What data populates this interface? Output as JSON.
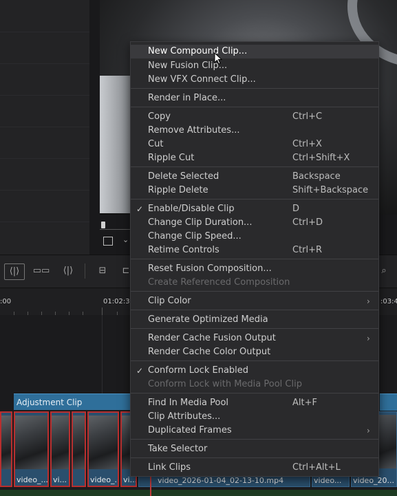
{
  "ruler": {
    "timecode_1": ":00",
    "timecode_2": "01:02:3",
    "timecode_3": ":03:4"
  },
  "adjustment_clip": {
    "label": "Adjustment Clip"
  },
  "clips": [
    {
      "name": "video_..."
    },
    {
      "name": "vi..."
    },
    {
      "name": ""
    },
    {
      "name": "video_..."
    },
    {
      "name": "vi..."
    },
    {
      "name": "video_2026-01-04_02-13-10.mp4"
    },
    {
      "name": "video..."
    },
    {
      "name": "video_20..."
    }
  ],
  "context_menu": {
    "items": {
      "new_compound_clip": {
        "label": "New Compound Clip..."
      },
      "new_fusion_clip": {
        "label": "New Fusion Clip..."
      },
      "new_vfx_connect_clip": {
        "label": "New VFX Connect Clip..."
      },
      "render_in_place": {
        "label": "Render in Place..."
      },
      "copy": {
        "label": "Copy",
        "shortcut": "Ctrl+C"
      },
      "remove_attributes": {
        "label": "Remove Attributes..."
      },
      "cut": {
        "label": "Cut",
        "shortcut": "Ctrl+X"
      },
      "ripple_cut": {
        "label": "Ripple Cut",
        "shortcut": "Ctrl+Shift+X"
      },
      "delete_selected": {
        "label": "Delete Selected",
        "shortcut": "Backspace"
      },
      "ripple_delete": {
        "label": "Ripple Delete",
        "shortcut": "Shift+Backspace"
      },
      "enable_disable_clip": {
        "label": "Enable/Disable Clip",
        "shortcut": "D",
        "checked": "✓"
      },
      "change_clip_duration": {
        "label": "Change Clip Duration...",
        "shortcut": "Ctrl+D"
      },
      "change_clip_speed": {
        "label": "Change Clip Speed..."
      },
      "retime_controls": {
        "label": "Retime Controls",
        "shortcut": "Ctrl+R"
      },
      "reset_fusion_composition": {
        "label": "Reset Fusion Composition..."
      },
      "create_referenced_composition": {
        "label": "Create Referenced Composition"
      },
      "clip_color": {
        "label": "Clip Color"
      },
      "generate_optimized_media": {
        "label": "Generate Optimized Media"
      },
      "render_cache_fusion_output": {
        "label": "Render Cache Fusion Output"
      },
      "render_cache_color_output": {
        "label": "Render Cache Color Output"
      },
      "conform_lock_enabled": {
        "label": "Conform Lock Enabled",
        "checked": "✓"
      },
      "conform_lock_media_pool_clip": {
        "label": "Conform Lock with Media Pool Clip"
      },
      "find_in_media_pool": {
        "label": "Find In Media Pool",
        "shortcut": "Alt+F"
      },
      "clip_attributes": {
        "label": "Clip Attributes..."
      },
      "duplicated_frames": {
        "label": "Duplicated Frames"
      },
      "take_selector": {
        "label": "Take Selector"
      },
      "link_clips": {
        "label": "Link Clips",
        "shortcut": "Ctrl+Alt+L"
      }
    },
    "submenu_glyph": "›"
  },
  "icons": {
    "toolbar": [
      "trim-edit-icon",
      "dynamic-trim-icon",
      "blade-icon",
      "insert-icon",
      "overwrite-icon"
    ],
    "viewer": [
      "crop-icon",
      "chevron-down-icon"
    ]
  },
  "colors": {
    "accent": "#2f6f9a",
    "playhead": "#c13a3a",
    "selected_clip_border": "#b82f2f"
  }
}
